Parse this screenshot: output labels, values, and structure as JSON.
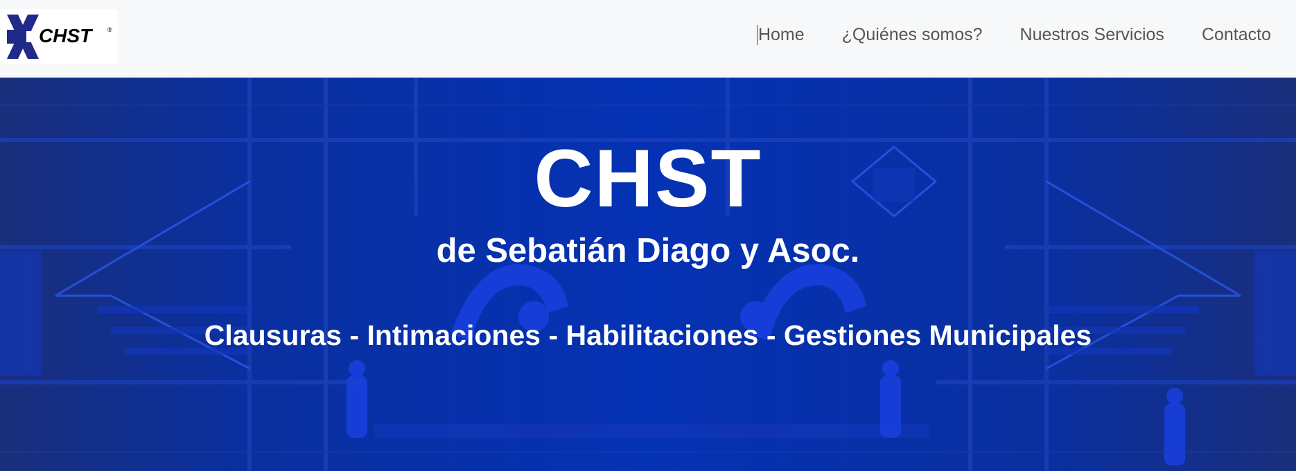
{
  "header": {
    "logo_text": "CHST",
    "logo_mark": "®",
    "nav": [
      {
        "label": "Home",
        "active": true
      },
      {
        "label": "¿Quiénes somos?"
      },
      {
        "label": "Nuestros Servicios"
      },
      {
        "label": "Contacto"
      }
    ]
  },
  "hero": {
    "title": "CHST",
    "subtitle": "de Sebatián Diago y Asoc.",
    "services": "Clausuras - Intimaciones - Habilitaciones - Gestiones Municipales"
  },
  "colors": {
    "navbar_bg": "#f7f8f9",
    "nav_text": "#555555",
    "hero_blue": "#0532b4",
    "logo_blue": "#1f2a8a",
    "hero_text": "#ffffff"
  }
}
